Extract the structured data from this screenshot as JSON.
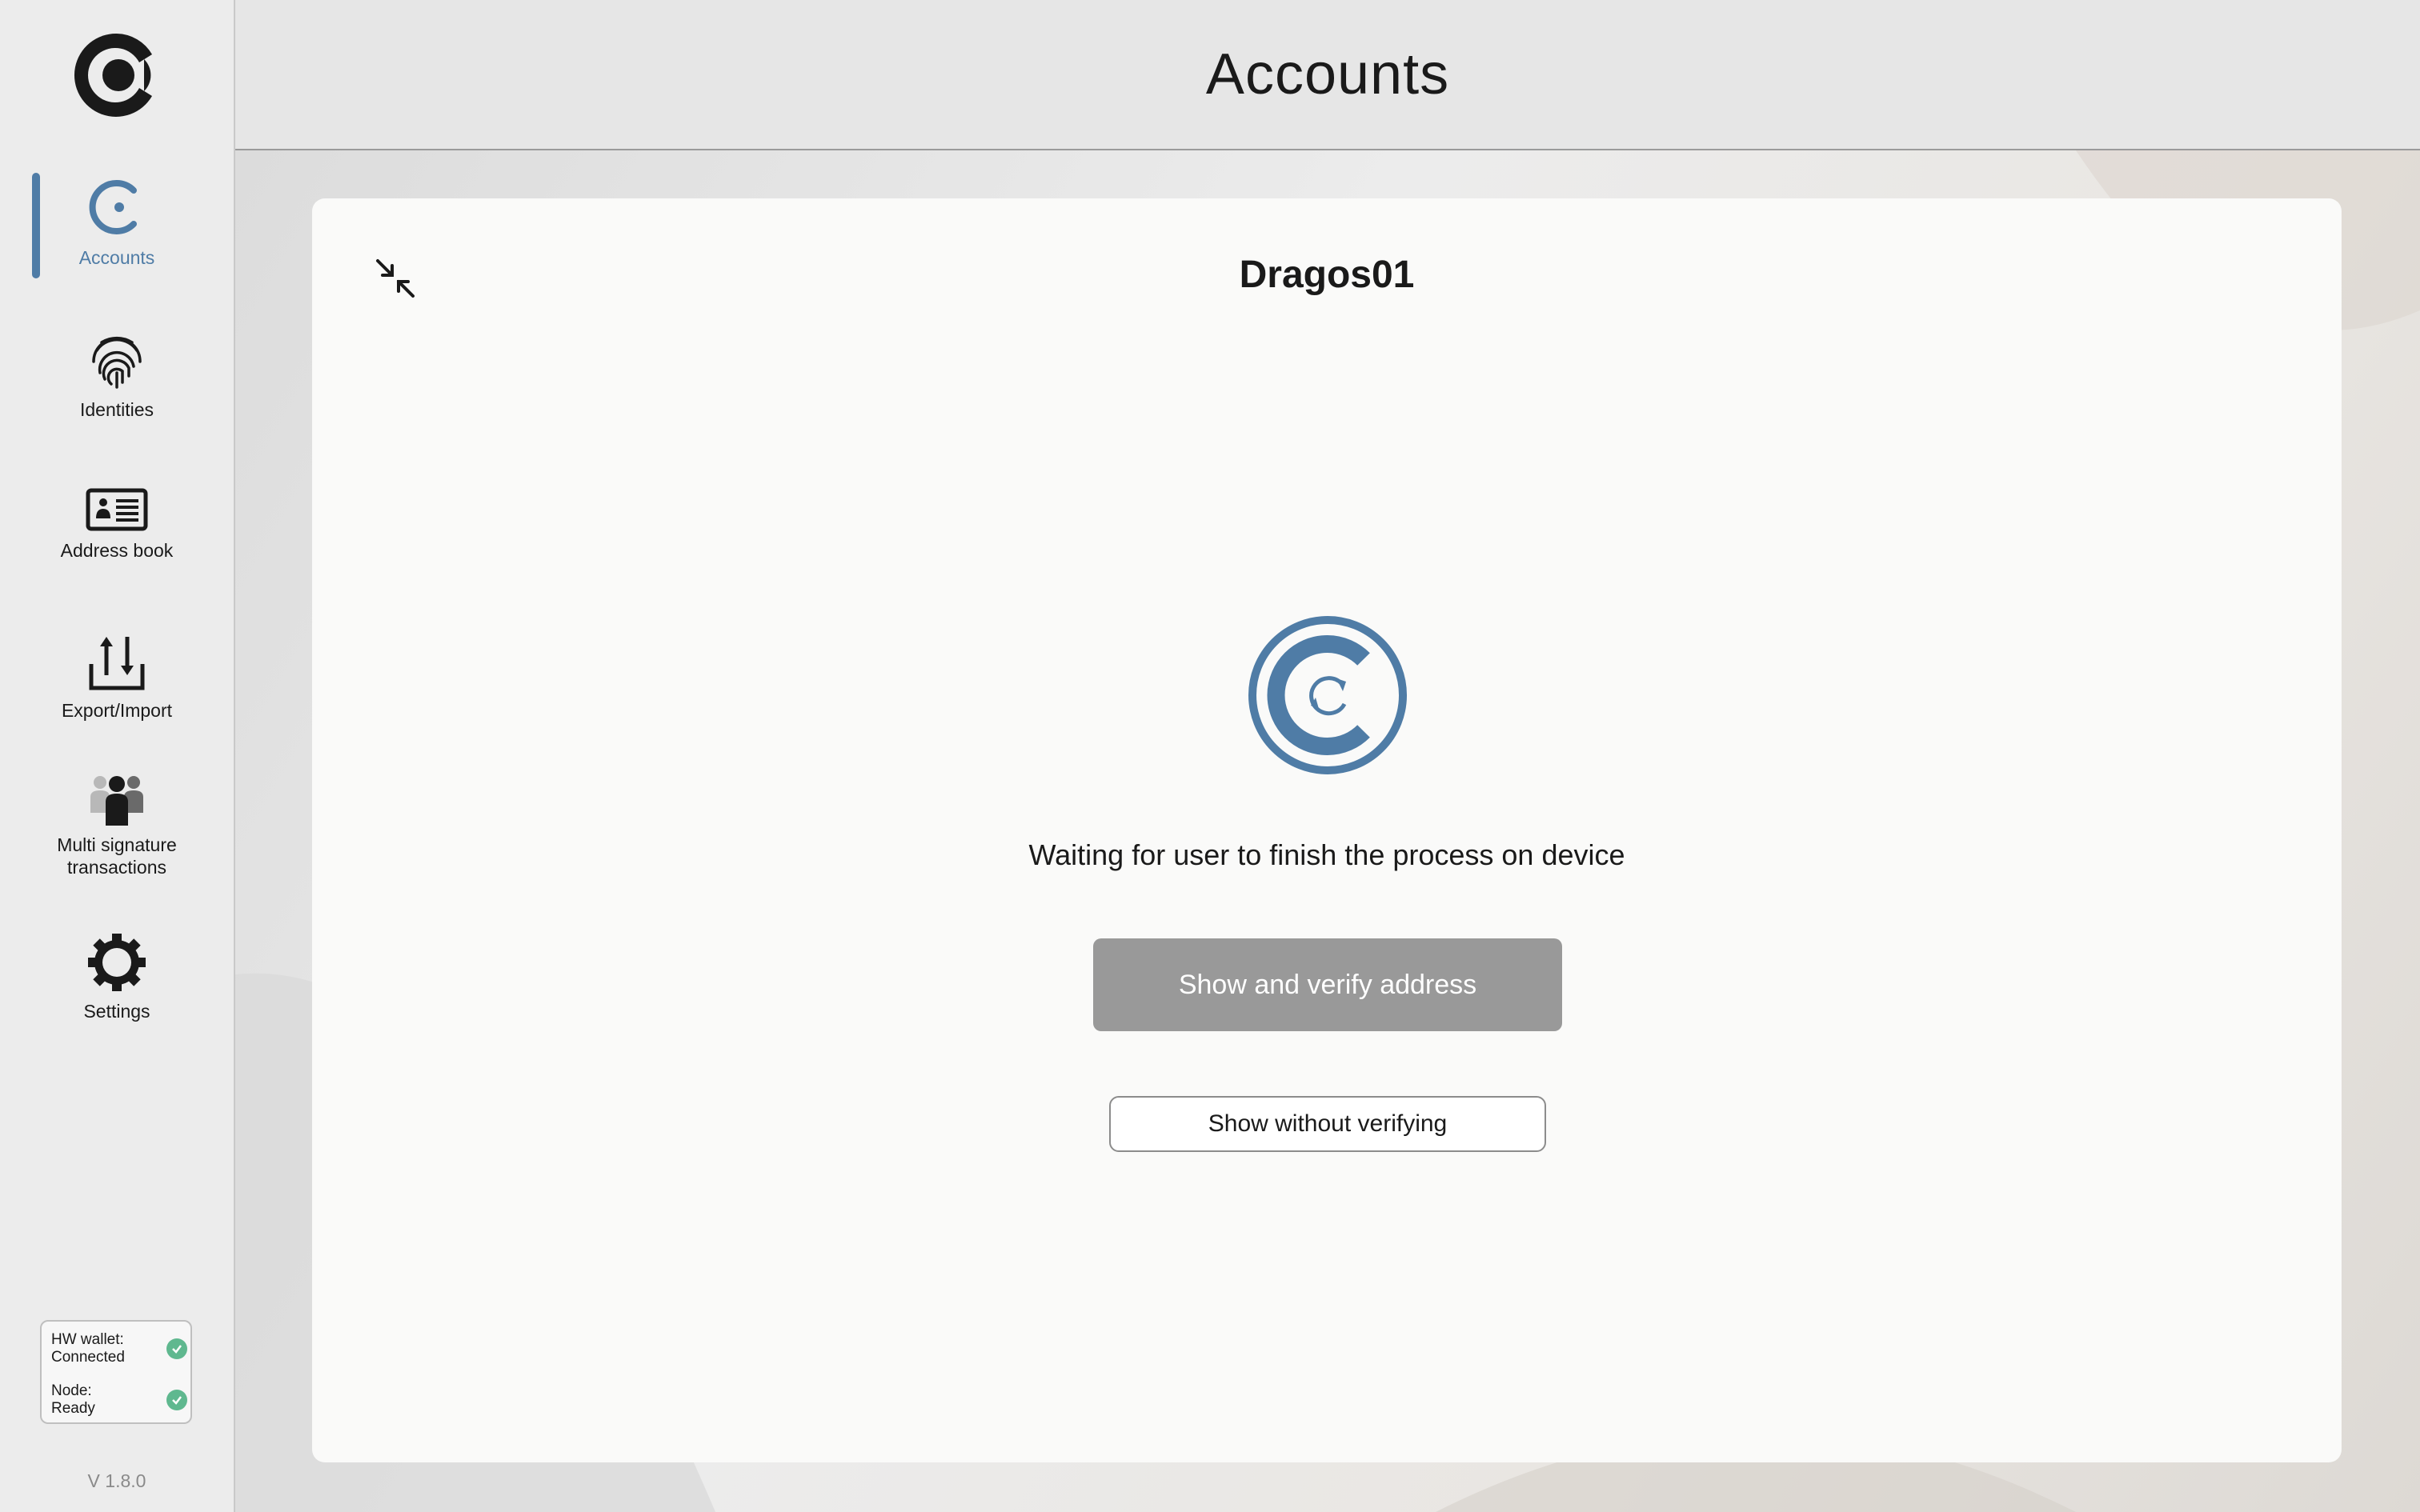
{
  "sidebar": {
    "items": [
      {
        "label": "Accounts",
        "icon": "accounts-icon"
      },
      {
        "label": "Identities",
        "icon": "fingerprint-icon"
      },
      {
        "label": "Address book",
        "icon": "id-card-icon"
      },
      {
        "label": "Export/Import",
        "icon": "export-import-icon"
      },
      {
        "label": "Multi signature\ntransactions",
        "icon": "people-icon"
      },
      {
        "label": "Settings",
        "icon": "gear-icon"
      }
    ],
    "active_index": 0,
    "status": {
      "hw_wallet_label": "HW wallet:",
      "hw_wallet_value": "Connected",
      "node_label": "Node:",
      "node_value": "Ready"
    },
    "version": "V 1.8.0"
  },
  "header": {
    "title": "Accounts"
  },
  "card": {
    "title": "Dragos01",
    "waiting_text": "Waiting for user to finish the process on device",
    "verify_button": "Show and verify address",
    "no_verify_button": "Show without verifying"
  },
  "colors": {
    "accent": "#4f7ca6",
    "status_ok": "#5fb88f",
    "disabled_button": "#999999"
  }
}
